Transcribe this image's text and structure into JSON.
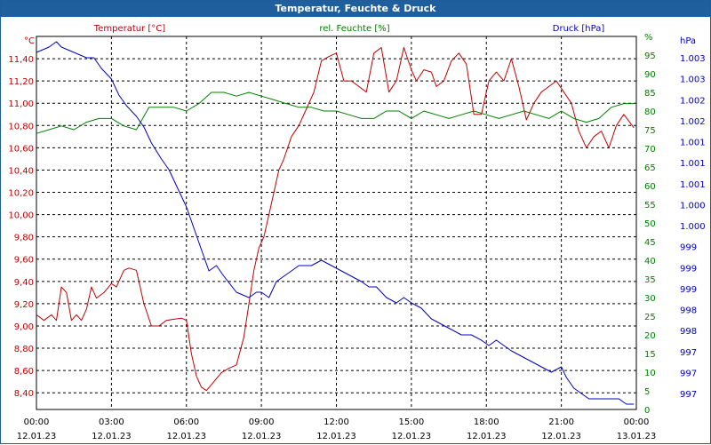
{
  "window": {
    "title": "Temperatur, Feuchte & Druck"
  },
  "chart_data": {
    "type": "line",
    "title": "Temperatur, Feuchte & Druck",
    "grid": true,
    "colors": {
      "temperature": "#c00000",
      "humidity": "#008000",
      "pressure": "#0000c0",
      "grid": "#000000",
      "titlebar": "#1f5f9e"
    },
    "axes": {
      "left": {
        "unit": "°C",
        "label": "Temperatur [°C]",
        "range": [
          8.25,
          11.6
        ],
        "ticks": [
          "8,40",
          "8,60",
          "8,80",
          "9,00",
          "9,20",
          "9,40",
          "9,60",
          "9,80",
          "10,00",
          "10,20",
          "10,40",
          "10,60",
          "10,80",
          "11,00",
          "11,20",
          "11,40"
        ]
      },
      "middle": {
        "unit": "%",
        "label": "rel. Feuchte [%]",
        "range": [
          0,
          100
        ],
        "ticks": [
          "0",
          "5",
          "10",
          "15",
          "20",
          "25",
          "30",
          "35",
          "40",
          "45",
          "50",
          "55",
          "60",
          "65",
          "70",
          "75",
          "80",
          "85",
          "90",
          "95",
          "%"
        ]
      },
      "right": {
        "unit": "hPa",
        "label": "Druck [hPa]",
        "range": [
          996.6,
          1003.6
        ],
        "ticks": [
          "997",
          "997",
          "997",
          "998",
          "998",
          "999",
          "999",
          "999",
          "1.000",
          "1.000",
          "1.001",
          "1.001",
          "1.001",
          "1.002",
          "1.002",
          "1.003",
          "1.003"
        ]
      }
    },
    "x": {
      "range": [
        0,
        24
      ],
      "ticks": [
        {
          "time": "00:00",
          "date": "12.01.23"
        },
        {
          "time": "03:00",
          "date": "12.01.23"
        },
        {
          "time": "06:00",
          "date": "12.01.23"
        },
        {
          "time": "09:00",
          "date": "12.01.23"
        },
        {
          "time": "12:00",
          "date": "12.01.23"
        },
        {
          "time": "15:00",
          "date": "12.01.23"
        },
        {
          "time": "18:00",
          "date": "12.01.23"
        },
        {
          "time": "21:00",
          "date": "12.01.23"
        },
        {
          "time": "00:00",
          "date": "13.01.23"
        }
      ]
    },
    "series": [
      {
        "name": "Temperatur [°C]",
        "axis": "left",
        "color": "#c00000",
        "x": [
          0,
          0.3,
          0.6,
          0.8,
          1.0,
          1.2,
          1.4,
          1.6,
          1.8,
          2.0,
          2.2,
          2.4,
          2.7,
          3.0,
          3.2,
          3.5,
          3.7,
          4.0,
          4.3,
          4.6,
          4.9,
          5.2,
          5.5,
          5.8,
          6.0,
          6.2,
          6.4,
          6.6,
          6.8,
          7.1,
          7.4,
          7.7,
          8.0,
          8.3,
          8.5,
          8.7,
          8.9,
          9.1,
          9.3,
          9.5,
          9.7,
          9.9,
          10.2,
          10.5,
          10.8,
          11.1,
          11.4,
          11.7,
          12.0,
          12.3,
          12.6,
          12.9,
          13.2,
          13.5,
          13.8,
          14.1,
          14.4,
          14.7,
          15.0,
          15.2,
          15.5,
          15.8,
          16.0,
          16.3,
          16.6,
          16.9,
          17.2,
          17.5,
          17.8,
          18.1,
          18.4,
          18.7,
          19.0,
          19.3,
          19.6,
          19.9,
          20.2,
          20.5,
          20.8,
          21.1,
          21.4,
          21.7,
          22.0,
          22.3,
          22.6,
          22.9,
          23.2,
          23.5,
          23.9
        ],
        "y": [
          9.1,
          9.05,
          9.1,
          9.05,
          9.35,
          9.3,
          9.05,
          9.1,
          9.05,
          9.15,
          9.35,
          9.25,
          9.3,
          9.38,
          9.35,
          9.5,
          9.52,
          9.5,
          9.2,
          9.0,
          9.0,
          9.05,
          9.06,
          9.07,
          9.05,
          8.75,
          8.55,
          8.45,
          8.42,
          8.5,
          8.58,
          8.62,
          8.65,
          8.9,
          9.2,
          9.5,
          9.7,
          9.8,
          10.0,
          10.2,
          10.4,
          10.5,
          10.7,
          10.8,
          10.95,
          11.1,
          11.38,
          11.42,
          11.45,
          11.2,
          11.2,
          11.15,
          11.1,
          11.45,
          11.5,
          11.1,
          11.2,
          11.5,
          11.3,
          11.2,
          11.3,
          11.28,
          11.15,
          11.2,
          11.38,
          11.45,
          11.35,
          10.9,
          10.9,
          11.2,
          11.28,
          11.2,
          11.4,
          11.15,
          10.85,
          11.0,
          11.1,
          11.15,
          11.2,
          11.1,
          11.0,
          10.75,
          10.6,
          10.7,
          10.75,
          10.6,
          10.8,
          10.9,
          10.78
        ]
      },
      {
        "name": "rel. Feuchte [%]",
        "axis": "middle",
        "color": "#008000",
        "x": [
          0,
          0.5,
          1.0,
          1.5,
          2.0,
          2.5,
          3.0,
          3.5,
          4.0,
          4.5,
          5.0,
          5.5,
          6.0,
          6.5,
          7.0,
          7.5,
          8.0,
          8.5,
          9.0,
          9.5,
          10.0,
          10.5,
          11.0,
          11.5,
          12.0,
          12.5,
          13.0,
          13.5,
          14.0,
          14.5,
          15.0,
          15.5,
          16.0,
          16.5,
          17.0,
          17.5,
          18.0,
          18.5,
          19.0,
          19.5,
          20.0,
          20.5,
          21.0,
          21.5,
          22.0,
          22.5,
          23.0,
          23.5,
          23.9
        ],
        "y": [
          74,
          75,
          76,
          75,
          77,
          78,
          78,
          76,
          75,
          81,
          81,
          81,
          80,
          82,
          85,
          85,
          84,
          85,
          84,
          83,
          82,
          81,
          81,
          80,
          80,
          79,
          78,
          78,
          80,
          80,
          78,
          80,
          79,
          78,
          79,
          80,
          79,
          78,
          79,
          80,
          79,
          78,
          80,
          78,
          77,
          78,
          81,
          82,
          82
        ]
      },
      {
        "name": "Druck [hPa]",
        "axis": "right",
        "color": "#0000c0",
        "x": [
          0,
          0.5,
          0.8,
          1.0,
          1.5,
          2.0,
          2.3,
          2.6,
          3.0,
          3.3,
          3.6,
          4.0,
          4.3,
          4.6,
          5.0,
          5.3,
          5.6,
          6.0,
          6.3,
          6.6,
          6.9,
          7.2,
          7.5,
          8.0,
          8.5,
          8.8,
          9.0,
          9.3,
          9.6,
          9.9,
          10.2,
          10.5,
          10.8,
          11.0,
          11.4,
          11.8,
          12.2,
          12.6,
          13.0,
          13.3,
          13.6,
          14.0,
          14.4,
          14.7,
          15.0,
          15.4,
          15.8,
          16.2,
          16.6,
          17.0,
          17.4,
          17.8,
          18.1,
          18.4,
          18.7,
          19.0,
          19.4,
          19.8,
          20.2,
          20.6,
          21.0,
          21.2,
          21.5,
          21.8,
          22.1,
          22.4,
          22.7,
          23.0,
          23.3,
          23.6,
          23.9
        ],
        "y": [
          1003.3,
          1003.4,
          1003.5,
          1003.4,
          1003.3,
          1003.2,
          1003.2,
          1003.0,
          1002.8,
          1002.5,
          1002.3,
          1002.1,
          1001.9,
          1001.6,
          1001.3,
          1001.1,
          1000.8,
          1000.4,
          1000.0,
          999.6,
          999.2,
          999.3,
          999.1,
          998.8,
          998.7,
          998.8,
          998.8,
          998.7,
          999.0,
          999.1,
          999.2,
          999.3,
          999.3,
          999.3,
          999.4,
          999.3,
          999.2,
          999.1,
          999.0,
          998.9,
          998.9,
          998.7,
          998.6,
          998.7,
          998.6,
          998.5,
          998.3,
          998.2,
          998.1,
          998.0,
          998.0,
          997.9,
          997.8,
          997.9,
          997.8,
          997.7,
          997.6,
          997.5,
          997.4,
          997.3,
          997.4,
          997.2,
          997.0,
          996.9,
          996.8,
          996.8,
          996.8,
          996.8,
          996.8,
          996.7,
          996.7
        ]
      }
    ]
  }
}
